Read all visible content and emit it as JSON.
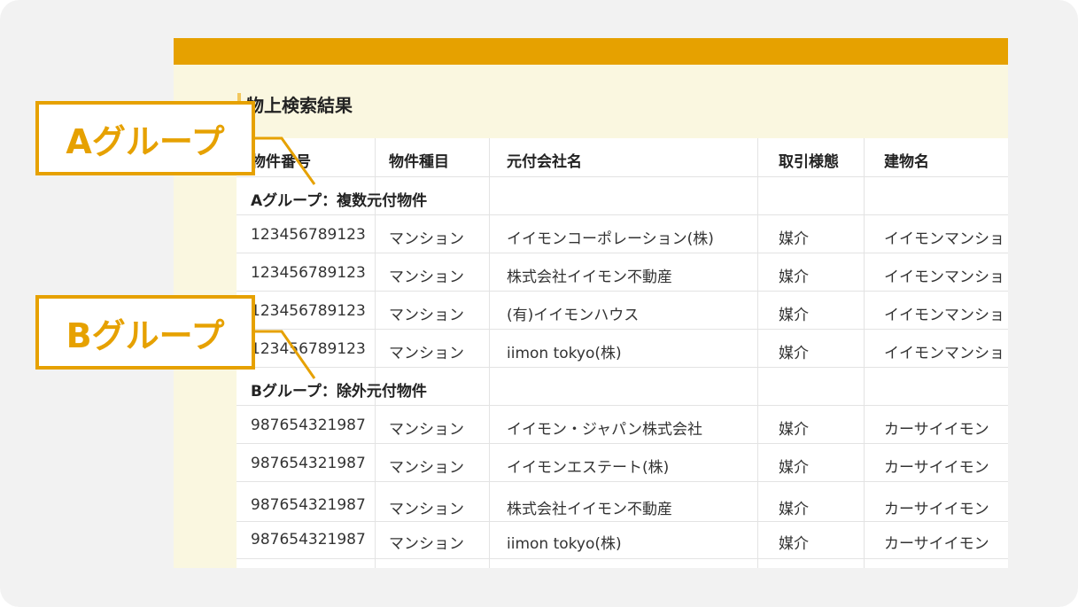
{
  "page_title": "物上検索結果",
  "table": {
    "headers": [
      "物件番号",
      "物件種目",
      "元付会社名",
      "取引様態",
      "建物名"
    ],
    "group_a_label": "Aグループ：複数元付物件",
    "group_a_rows": [
      [
        "123456789123",
        "マンション",
        "イイモンコーポレーション(株)",
        "媒介",
        "イイモンマンショ"
      ],
      [
        "123456789123",
        "マンション",
        "株式会社イイモン不動産",
        "媒介",
        "イイモンマンショ"
      ],
      [
        "123456789123",
        "マンション",
        "(有)イイモンハウス",
        "媒介",
        "イイモンマンショ"
      ],
      [
        "123456789123",
        "マンション",
        "iimon tokyo(株)",
        "媒介",
        "イイモンマンショ"
      ]
    ],
    "group_b_label": "Bグループ：除外元付物件",
    "group_b_rows": [
      [
        "987654321987",
        "マンション",
        "イイモン・ジャパン株式会社",
        "媒介",
        "カーサイイモン"
      ],
      [
        "987654321987",
        "マンション",
        "イイモンエステート(株)",
        "媒介",
        "カーサイイモン"
      ],
      [
        "987654321987",
        "マンション",
        "株式会社イイモン不動産",
        "媒介",
        "カーサイイモン"
      ],
      [
        "987654321987",
        "マンション",
        "iimon tokyo(株)",
        "媒介",
        "カーサイイモン"
      ]
    ]
  },
  "callouts": {
    "a": "Aグループ",
    "b": "Bグループ"
  },
  "colors": {
    "accent": "#e6a100",
    "panel_bg": "#faf7e0",
    "card_bg": "#f2f2f2"
  }
}
